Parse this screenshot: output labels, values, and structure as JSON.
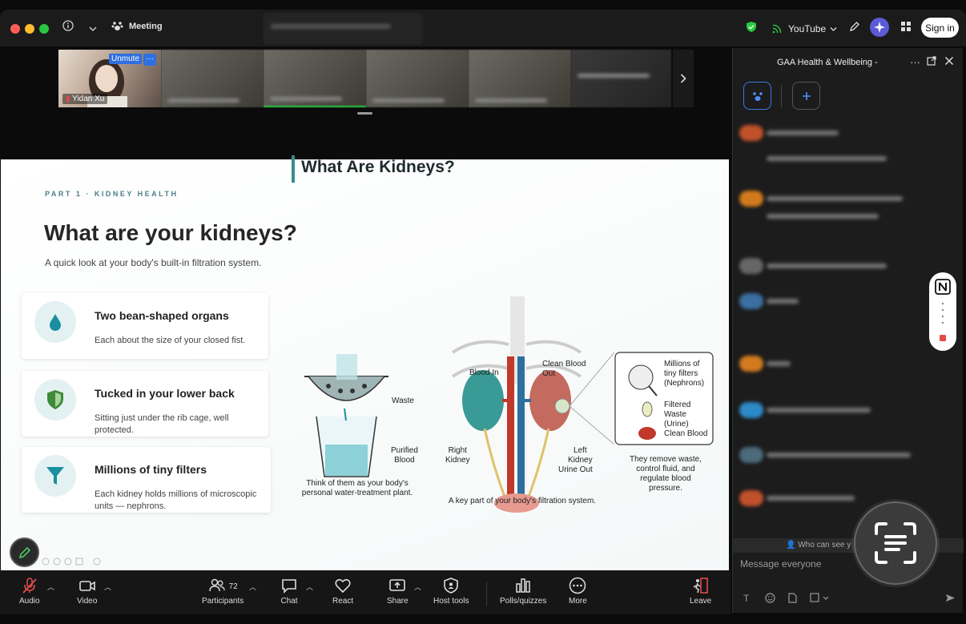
{
  "titlebar": {
    "meeting_label": "Meeting",
    "stream_label": "YouTube",
    "sign_in": "Sign in"
  },
  "gallery": {
    "self_name": "Yidan Xu",
    "unmute_label": "Unmute",
    "more_label": "···"
  },
  "slide": {
    "eyebrow": "PART 1 · KIDNEY HEALTH",
    "title": "What are your kidneys?",
    "subtitle": "A quick look at your body's built-in filtration system.",
    "cards": [
      {
        "heading": "Two bean-shaped organs",
        "text": "Each about the size of your closed fist.",
        "icon": "water-drop-icon"
      },
      {
        "heading": "Tucked in your lower back",
        "text": "Sitting just under the rib cage, well protected.",
        "icon": "shield-icon"
      },
      {
        "heading": "Millions of tiny filters",
        "text": "Each kidney holds millions of microscopic units — nephrons.",
        "icon": "funnel-icon"
      }
    ],
    "infographic": {
      "title": "What Are Kidneys?",
      "waste": "Waste",
      "purified": "Purified\nBlood",
      "think": "Think of them as your body's\npersonal water-treatment plant.",
      "blood_in": "Blood In",
      "clean_out": "Clean Blood\nOut",
      "right_kidney": "Right\nKidney",
      "left_kidney": "Left\nKidney",
      "urine_out": "Urine Out",
      "key_part": "A key part of your body's filtration system.",
      "millions": "Millions of\ntiny filters\n(Nephrons)",
      "filtered": "Filtered\nWaste\n(Urine)",
      "clean_blood": "Clean Blood",
      "remove": "They remove waste,\ncontrol fluid, and\nregulate blood\npressure."
    }
  },
  "panel": {
    "title": "GAA Health & Wellbeing -",
    "who_can_see": "Who can see y",
    "message_placeholder": "Message everyone"
  },
  "toolbar": {
    "audio": "Audio",
    "video": "Video",
    "participants": "Participants",
    "participants_count": "72",
    "chat": "Chat",
    "react": "React",
    "share": "Share",
    "host_tools": "Host tools",
    "polls": "Polls/quizzes",
    "more": "More",
    "leave": "Leave"
  },
  "colors": {
    "accent_blue": "#2f6fe0",
    "teal": "#3b8c8c",
    "leave_red": "#e04a4a"
  }
}
